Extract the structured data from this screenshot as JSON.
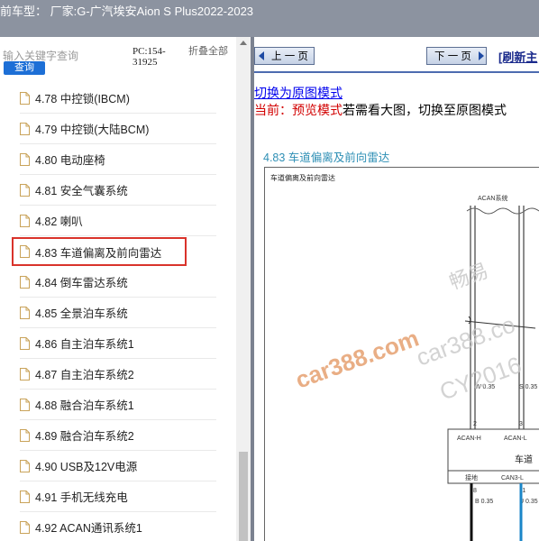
{
  "header": {
    "title": "前车型： 厂家:G-广汽埃安Aion S Plus2022-2023"
  },
  "sidebar": {
    "search_placeholder": "输入关键字查询",
    "search_button": "查询",
    "pc_code": "PC:154-31925",
    "collapse_all": "折叠全部",
    "items": [
      {
        "number": "4.78",
        "label": "4.78 中控锁(IBCM)"
      },
      {
        "number": "4.79",
        "label": "4.79 中控锁(大陆BCM)"
      },
      {
        "number": "4.80",
        "label": "4.80 电动座椅"
      },
      {
        "number": "4.81",
        "label": "4.81 安全气囊系统"
      },
      {
        "number": "4.82",
        "label": "4.82 喇叭"
      },
      {
        "number": "4.83",
        "label": "4.83 车道偏离及前向雷达",
        "selected": true
      },
      {
        "number": "4.84",
        "label": "4.84 倒车雷达系统"
      },
      {
        "number": "4.85",
        "label": "4.85 全景泊车系统"
      },
      {
        "number": "4.86",
        "label": "4.86 自主泊车系统1"
      },
      {
        "number": "4.87",
        "label": "4.87 自主泊车系统2"
      },
      {
        "number": "4.88",
        "label": "4.88 融合泊车系统1"
      },
      {
        "number": "4.89",
        "label": "4.89 融合泊车系统2"
      },
      {
        "number": "4.90",
        "label": "4.90 USB及12V电源"
      },
      {
        "number": "4.91",
        "label": "4.91 手机无线充电"
      },
      {
        "number": "4.92",
        "label": "4.92 ACAN通讯系统1"
      }
    ]
  },
  "toolbar": {
    "prev_label": "上 一 页",
    "next_label": "下 一 页",
    "refresh_label": "[刷新主"
  },
  "content": {
    "mode_switch": "切换为原图模式",
    "mode_current_prefix": "当前：预览模式",
    "mode_current_suffix": "若需看大图，切换至原图模式",
    "section_title": "4.83 车道偏离及前向雷达",
    "diagram": {
      "caption": "车道偏离及前向雷达",
      "bus_label": "ACAN系统",
      "wire_left": "W 0.35",
      "wire_right": "S 0.35",
      "pin_left": "2",
      "pin_right": "3",
      "conn_label_left": "ACAN-H",
      "conn_label_right": "ACAN-L",
      "module_label": "车道",
      "ground_label": "接地",
      "can3_label": "CAN3-L",
      "pin_bottom_left": "8",
      "pin_bottom_right": "11",
      "wire_bottom_left": "B 0.35",
      "wire_bottom_right": "U 0.35"
    },
    "watermarks": {
      "wm1": "car388.com",
      "wm2": "畅易",
      "wm3": "car388.co",
      "wm4": "CY2016"
    }
  },
  "colors": {
    "header_bg": "#8c93a0",
    "search_button": "#1d6fd6",
    "selected_outline": "#d9332b",
    "section_title": "#2e8fb5",
    "mode_current": "#d20000",
    "link": "#0000ee"
  }
}
